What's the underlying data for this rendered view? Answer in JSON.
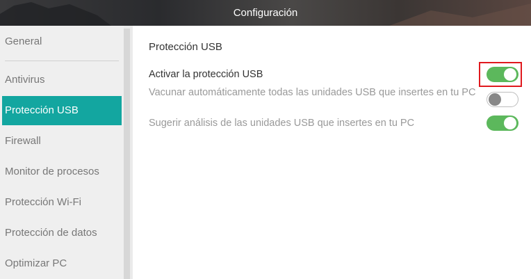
{
  "window": {
    "title": "Configuración"
  },
  "sidebar": {
    "items": [
      {
        "label": "General",
        "active": false
      },
      {
        "label": "Antivirus",
        "active": false
      },
      {
        "label": "Protección USB",
        "active": true
      },
      {
        "label": "Firewall",
        "active": false
      },
      {
        "label": "Monitor de procesos",
        "active": false
      },
      {
        "label": "Protección Wi-Fi",
        "active": false
      },
      {
        "label": "Protección de datos",
        "active": false
      },
      {
        "label": "Optimizar PC",
        "active": false
      }
    ]
  },
  "main": {
    "section_title": "Protección USB",
    "settings": [
      {
        "label": "Activar la protección USB",
        "enabled": true
      },
      {
        "label": "Vacunar automáticamente todas las unidades USB que insertes en tu PC",
        "enabled": false
      },
      {
        "label": "Sugerir análisis de las unidades USB que insertes en tu PC",
        "enabled": true
      }
    ]
  },
  "colors": {
    "accent": "#13a6a0",
    "toggle_on": "#5cb85c",
    "highlight": "#e0191e"
  }
}
